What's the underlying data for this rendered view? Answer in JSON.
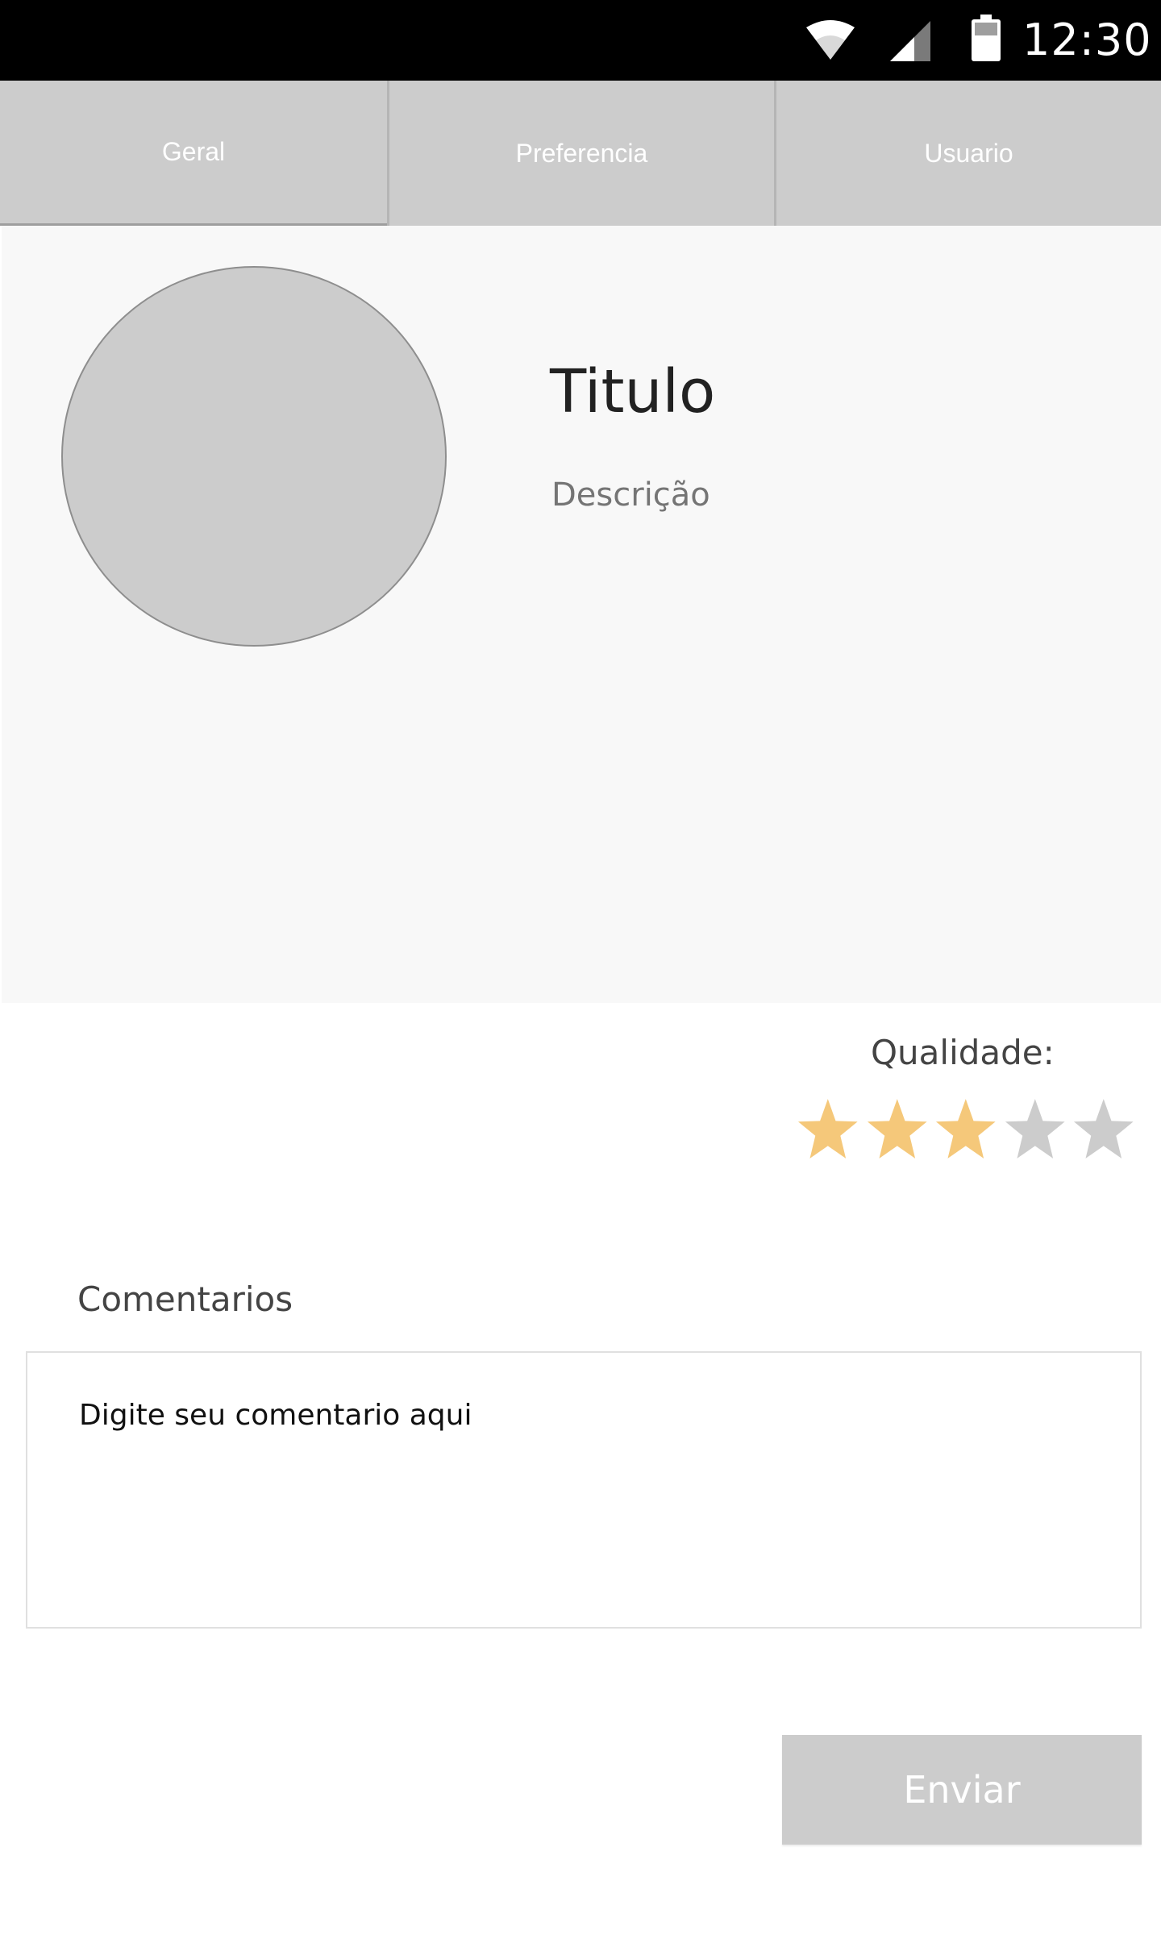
{
  "status_bar": {
    "time": "12:30",
    "icons": [
      "wifi-icon",
      "signal-icon",
      "battery-icon"
    ]
  },
  "tabs": [
    {
      "label": "Geral",
      "active": true
    },
    {
      "label": "Preferencia",
      "active": false
    },
    {
      "label": "Usuario",
      "active": false
    }
  ],
  "profile": {
    "title": "Titulo",
    "description": "Descrição"
  },
  "rating": {
    "label": "Qualidade:",
    "value": 3,
    "max": 5,
    "filled_color": "#f5c87a",
    "empty_color": "#cccccc"
  },
  "comments": {
    "label": "Comentarios",
    "placeholder": "Digite seu comentario aqui"
  },
  "submit": {
    "label": "Enviar"
  },
  "colors": {
    "status_bar": "#000000",
    "tab_background": "#cccccc",
    "hero_background": "#f8f8f8",
    "button_background": "#cccccc"
  }
}
